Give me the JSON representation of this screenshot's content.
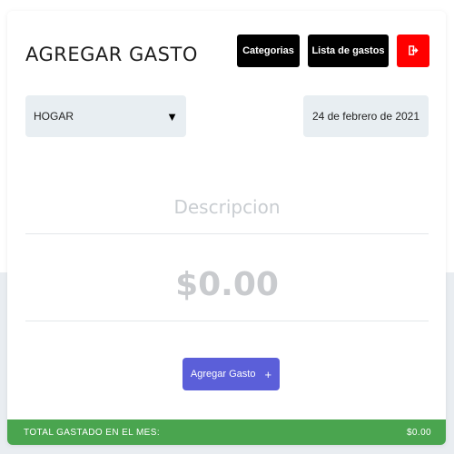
{
  "header": {
    "title": "AGREGAR GASTO",
    "categories_label": "Categorias",
    "expense_list_label": "Lista de gastos",
    "exit_icon": "sign-out-icon",
    "exit_color": "#ff0000"
  },
  "form": {
    "category_selected": "HOGAR",
    "category_caret": "▼",
    "date": "24 de febrero de 2021",
    "description_placeholder": "Descripcion",
    "amount_placeholder": "$0.00",
    "submit_label": "Agregar Gasto",
    "submit_icon": "+",
    "submit_color": "#5b5fd9"
  },
  "footer": {
    "total_label": "TOTAL GASTADO EN EL MES:",
    "total_value": "$0.00",
    "color": "#4aa54f"
  }
}
